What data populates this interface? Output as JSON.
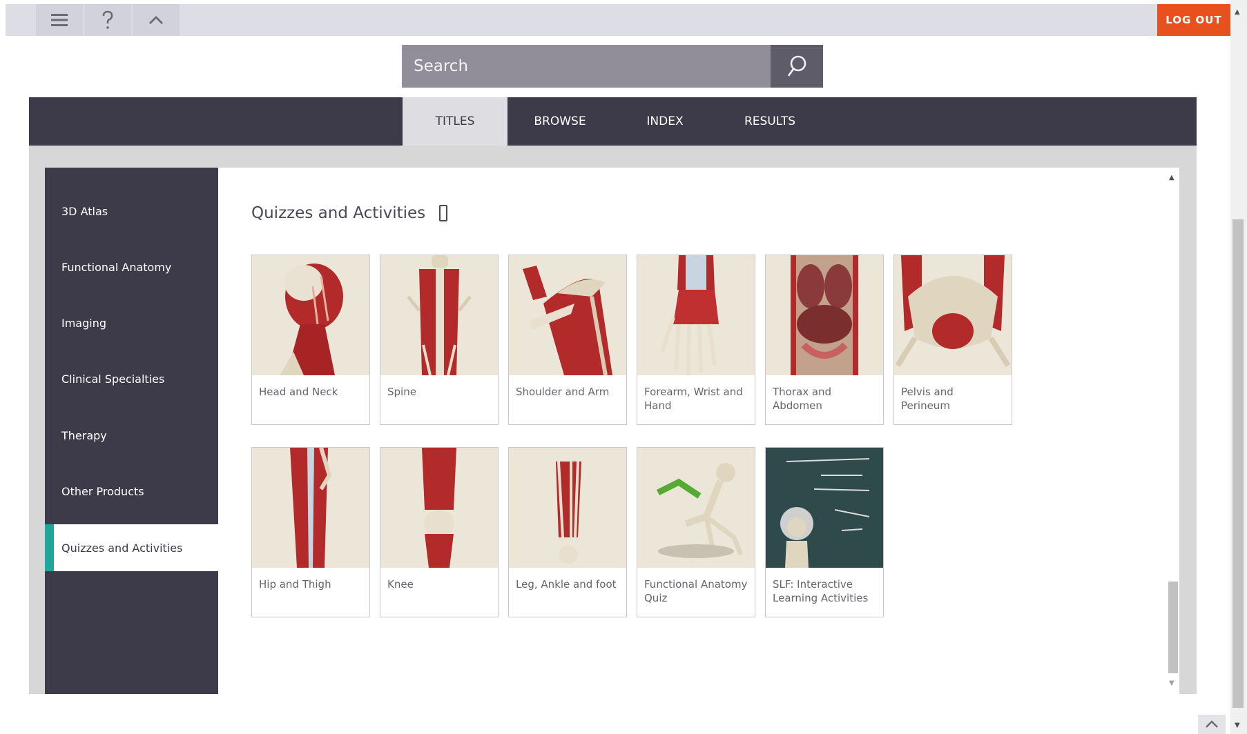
{
  "topbar": {
    "menu_icon": "hamburger-icon",
    "help_icon": "question-icon",
    "collapse_icon": "chevron-up-icon",
    "logout_label": "LOG OUT",
    "accent_color": "#e8501e"
  },
  "search": {
    "placeholder": "Search",
    "button_icon": "search-icon"
  },
  "tabs": [
    {
      "label": "TITLES",
      "active": true
    },
    {
      "label": "BROWSE",
      "active": false
    },
    {
      "label": "INDEX",
      "active": false
    },
    {
      "label": "RESULTS",
      "active": false
    }
  ],
  "sidebar": {
    "items": [
      {
        "label": "3D Atlas"
      },
      {
        "label": "Functional Anatomy"
      },
      {
        "label": "Imaging"
      },
      {
        "label": "Clinical Specialties"
      },
      {
        "label": "Therapy"
      },
      {
        "label": "Other Products"
      },
      {
        "label": "Quizzes and Activities",
        "active": true
      }
    ],
    "active_color": "#1fa89a"
  },
  "main": {
    "section_title": "Quizzes and Activities",
    "section_icon": "mobile-device-icon",
    "cards": [
      {
        "label": "Head and Neck"
      },
      {
        "label": "Spine"
      },
      {
        "label": "Shoulder and Arm"
      },
      {
        "label": "Forearm, Wrist and Hand"
      },
      {
        "label": "Thorax and Abdomen"
      },
      {
        "label": "Pelvis and Perineum"
      },
      {
        "label": "Hip and Thigh"
      },
      {
        "label": "Knee"
      },
      {
        "label": "Leg, Ankle and foot"
      },
      {
        "label": "Functional Anatomy Quiz"
      },
      {
        "label": "SLF: Interactive Learning Activities"
      }
    ]
  }
}
